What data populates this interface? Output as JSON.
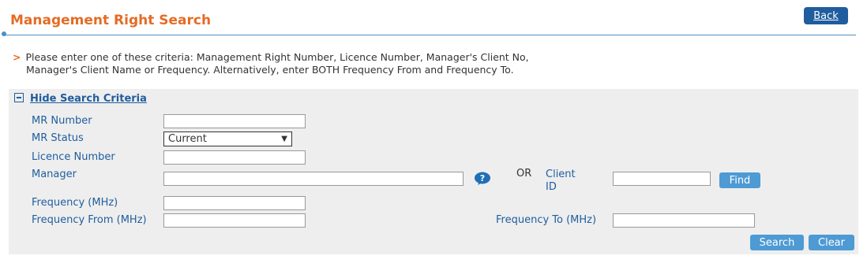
{
  "page": {
    "title": "Management Right Search",
    "back_label": "Back"
  },
  "info": {
    "line1": "Please enter one of these criteria: Management Right Number, Licence Number, Manager's Client No,",
    "line2": "Manager's Client Name or Frequency. Alternatively, enter BOTH Frequency From and Frequency To."
  },
  "criteria": {
    "toggle_label": "Hide Search Criteria",
    "mr_number_label": "MR Number",
    "mr_number_value": "",
    "mr_status_label": "MR Status",
    "mr_status_value": "Current",
    "licence_number_label": "Licence Number",
    "licence_number_value": "",
    "manager_label": "Manager",
    "manager_value": "",
    "or_label": "OR",
    "client_label_1": "Client",
    "client_label_2": "ID",
    "client_id_value": "",
    "find_label": "Find",
    "frequency_label": "Frequency (MHz)",
    "frequency_value": "",
    "frequency_from_label": "Frequency From (MHz)",
    "frequency_from_value": "",
    "frequency_to_label": "Frequency To (MHz)",
    "frequency_to_value": ""
  },
  "actions": {
    "search_label": "Search",
    "clear_label": "Clear"
  },
  "icons": {
    "help": "question-bubble-icon",
    "toggle": "collapse-minus-icon"
  },
  "colors": {
    "title": "#e46c26",
    "link": "#1f5d9e",
    "button": "#4d9ad4",
    "panel": "#eeeeee"
  }
}
